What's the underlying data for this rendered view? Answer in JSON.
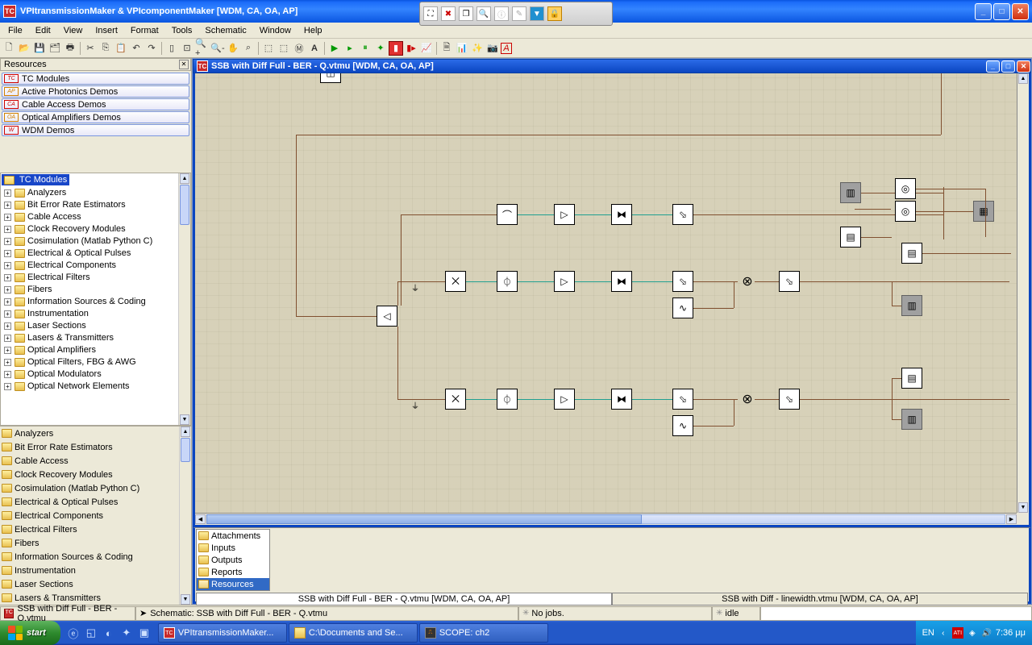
{
  "title": "VPItransmissionMaker & VPIcomponentMaker [WDM, CA, OA, AP]",
  "menu": [
    "File",
    "Edit",
    "View",
    "Insert",
    "Format",
    "Tools",
    "Schematic",
    "Window",
    "Help"
  ],
  "resources_header": "Resources",
  "resource_cats": [
    {
      "tag": "TC",
      "cls": "tc",
      "label": "TC Modules"
    },
    {
      "tag": "AP",
      "cls": "ap",
      "label": "Active Photonics Demos"
    },
    {
      "tag": "CA",
      "cls": "ca",
      "label": "Cable Access Demos"
    },
    {
      "tag": "OA",
      "cls": "oa",
      "label": "Optical Amplifiers Demos"
    },
    {
      "tag": "W",
      "cls": "w",
      "label": "WDM Demos"
    }
  ],
  "tree_root": "TC Modules",
  "tree_items": [
    "Analyzers",
    "Bit Error Rate Estimators",
    "Cable Access",
    "Clock Recovery Modules",
    "Cosimulation (Matlab Python C)",
    "Electrical & Optical Pulses",
    "Electrical Components",
    "Electrical Filters",
    "Fibers",
    "Information Sources & Coding",
    "Instrumentation",
    "Laser Sections",
    "Lasers & Transmitters",
    "Optical Amplifiers",
    "Optical Filters, FBG & AWG",
    "Optical Modulators",
    "Optical Network Elements"
  ],
  "flat_items": [
    "Analyzers",
    "Bit Error Rate Estimators",
    "Cable Access",
    "Clock Recovery Modules",
    "Cosimulation (Matlab Python C)",
    "Electrical & Optical Pulses",
    "Electrical Components",
    "Electrical Filters",
    "Fibers",
    "Information Sources & Coding",
    "Instrumentation",
    "Laser Sections",
    "Lasers & Transmitters"
  ],
  "doc_title": "SSB with Diff Full - BER - Q.vtmu [WDM, CA, OA, AP]",
  "attach_items": [
    "Attachments",
    "Inputs",
    "Outputs",
    "Reports",
    "Resources"
  ],
  "attach_selected": 4,
  "doc_tabs": [
    "SSB with Diff Full - BER - Q.vtmu [WDM, CA, OA, AP]",
    "SSB with Diff - linewidth.vtmu [WDM, CA, OA, AP]"
  ],
  "status": {
    "left": "SSB with Diff Full - BER - Q.vtmu",
    "mid": "Schematic: SSB with Diff Full - BER - Q.vtmu",
    "jobs": "No jobs.",
    "idle": "idle"
  },
  "taskbar": {
    "start": "start",
    "tasks": [
      {
        "icon": "tc",
        "label": "VPItransmissionMaker..."
      },
      {
        "icon": "fld",
        "label": "C:\\Documents and Se..."
      },
      {
        "icon": "scope",
        "label": "SCOPE: ch2"
      }
    ],
    "lang": "EN",
    "time": "7:36 μμ"
  }
}
